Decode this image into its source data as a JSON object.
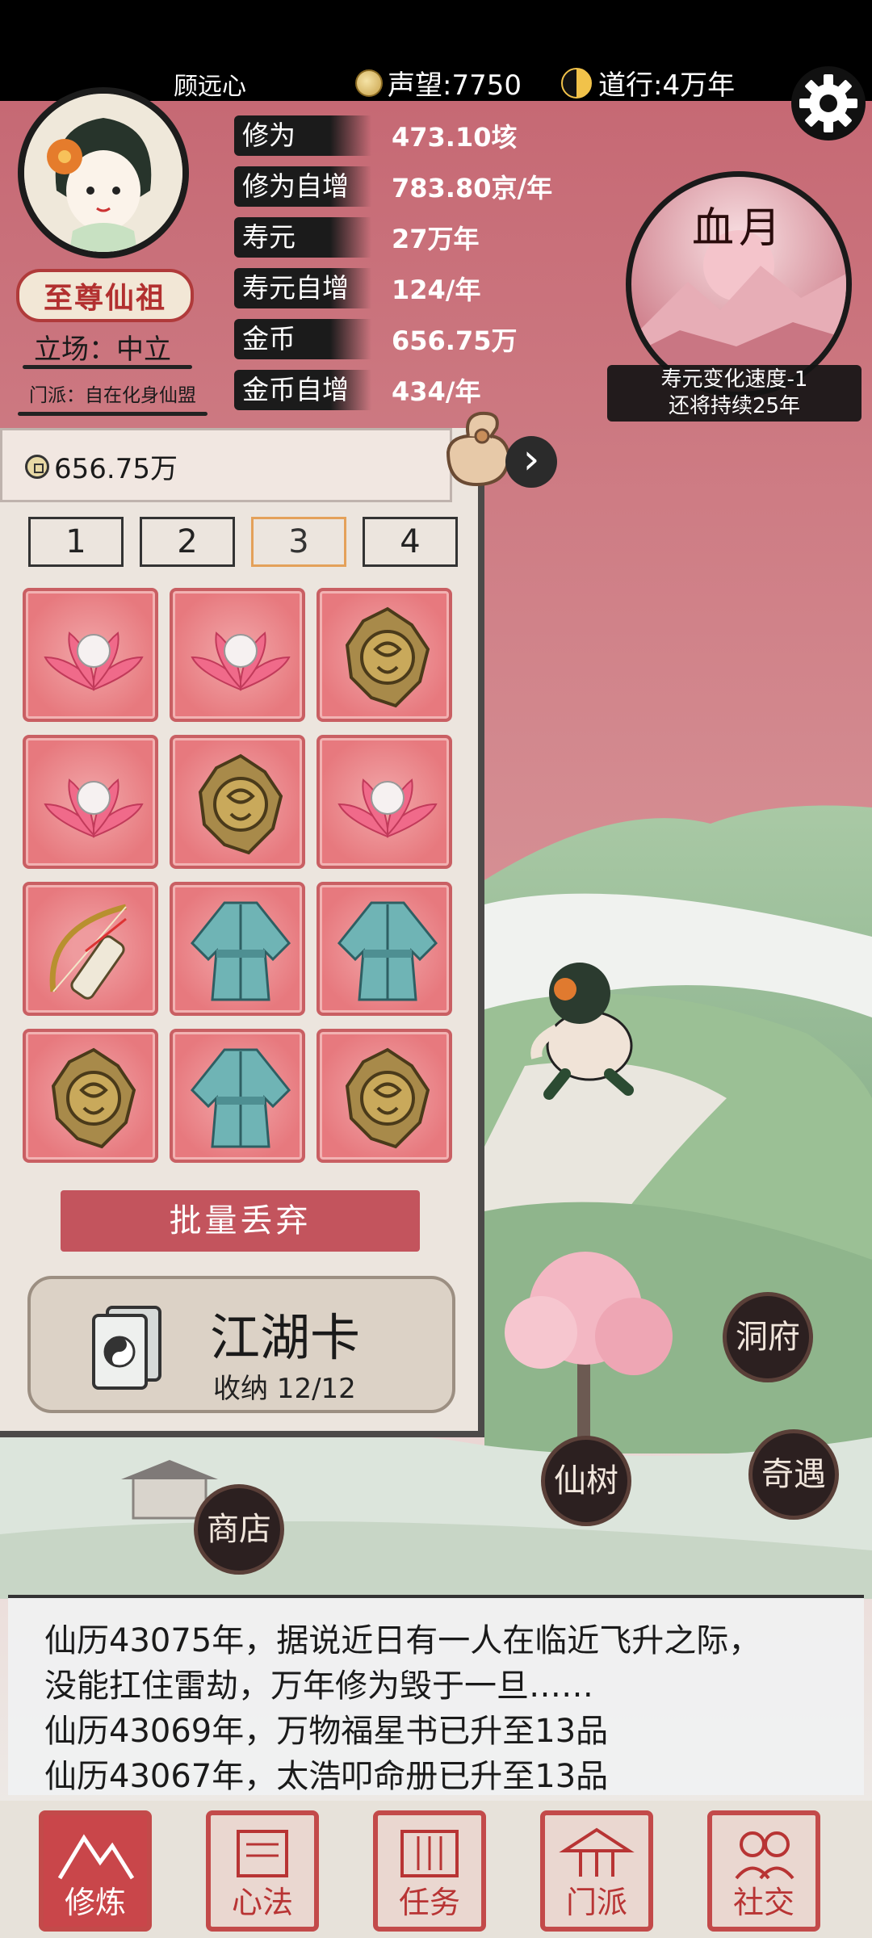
{
  "header": {
    "player_name": "顾远心",
    "prestige": "声望:7750",
    "daoxing": "道行:4万年",
    "rank_title": "至尊仙祖",
    "stance": "立场：中立",
    "sect": "门派：自在化身仙盟"
  },
  "stats": [
    {
      "label": "修为",
      "value": "473.10垓"
    },
    {
      "label": "修为自增",
      "value": "783.80京/年"
    },
    {
      "label": "寿元",
      "value": "27万年"
    },
    {
      "label": "寿元自增",
      "value": "124/年"
    },
    {
      "label": "金币",
      "value": "656.75万"
    },
    {
      "label": "金币自增",
      "value": "434/年"
    }
  ],
  "event": {
    "title": "血月",
    "caption_line1": "寿元变化速度-1",
    "caption_line2": "还将持续25年"
  },
  "bag": {
    "money": "656.75万",
    "tabs": [
      "1",
      "2",
      "3",
      "4"
    ],
    "active_tab": "3",
    "items": [
      "lotus-pearl",
      "lotus-pearl",
      "bronze-talisman",
      "lotus-pearl",
      "bronze-talisman",
      "lotus-pearl",
      "bow-quiver",
      "jade-robe",
      "jade-robe",
      "bronze-talisman",
      "jade-robe",
      "bronze-talisman"
    ],
    "discard_label": "批量丢弃",
    "card_title": "江湖卡",
    "card_subtitle": "收纳 12/12"
  },
  "map_buttons": {
    "cave": "洞府",
    "encounter": "奇遇",
    "tree": "仙树",
    "shop": "商店"
  },
  "log": [
    "仙历43075年，据说近日有一人在临近飞升之际，",
    "没能扛住雷劫，万年修为毁于一旦……",
    "仙历43069年，万物福星书已升至13品",
    "仙历43067年，太浩叩命册已升至13品"
  ],
  "nav": [
    {
      "label": "修炼",
      "active": true
    },
    {
      "label": "心法",
      "active": false
    },
    {
      "label": "任务",
      "active": false
    },
    {
      "label": "门派",
      "active": false
    },
    {
      "label": "社交",
      "active": false
    }
  ],
  "colors": {
    "sky": "#c9707a",
    "slot": "#e7797e",
    "accent_red": "#c3545d"
  }
}
